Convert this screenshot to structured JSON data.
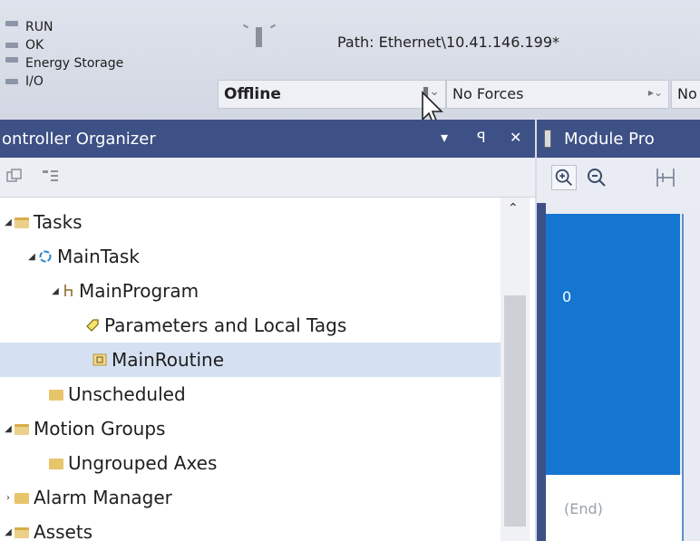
{
  "status": {
    "indicators": [
      "RUN",
      "OK",
      "Energy Storage",
      "I/O"
    ],
    "path": "Path:  Ethernet\\10.41.146.199*",
    "mode": "Offline",
    "forces": "No Forces",
    "edits": "No"
  },
  "organizer": {
    "title": "ontroller Organizer",
    "buttons": {
      "menu": "▾",
      "pin": "ꟼ",
      "close": "✕"
    },
    "tree": [
      {
        "label": "Tasks",
        "depth": 0,
        "expander": "◢",
        "icon": "folder-open-icon"
      },
      {
        "label": "MainTask",
        "depth": 1,
        "expander": "◢",
        "icon": "task-icon"
      },
      {
        "label": "MainProgram",
        "depth": 2,
        "expander": "◢",
        "icon": "program-icon"
      },
      {
        "label": "Parameters and Local Tags",
        "depth": 3,
        "expander": "",
        "icon": "tag-icon"
      },
      {
        "label": "MainRoutine",
        "depth": 3,
        "expander": "",
        "icon": "routine-icon",
        "selected": true
      },
      {
        "label": "Unscheduled",
        "depth": 1,
        "expander": "",
        "icon": "folder-icon"
      },
      {
        "label": "Motion Groups",
        "depth": 0,
        "expander": "◢",
        "icon": "folder-open-icon"
      },
      {
        "label": "Ungrouped Axes",
        "depth": 1,
        "expander": "",
        "icon": "folder-icon"
      },
      {
        "label": "Alarm Manager",
        "depth": 0,
        "expander": "›",
        "icon": "folder-icon"
      },
      {
        "label": "Assets",
        "depth": 0,
        "expander": "◢",
        "icon": "folder-open-icon"
      }
    ]
  },
  "module": {
    "title": "Module Pro",
    "rung_number": "0",
    "end_label": "(End)"
  },
  "colors": {
    "title_bar": "#3d5186",
    "rung_selected": "#1576d1",
    "tree_selected": "#d5e1f2"
  }
}
